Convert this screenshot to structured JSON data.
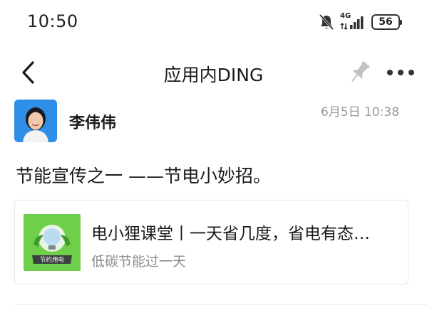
{
  "status_bar": {
    "time": "10:50",
    "network": "4G",
    "battery": "56"
  },
  "header": {
    "title": "应用内DING"
  },
  "message": {
    "sender": "李伟伟",
    "timestamp": "6月5日 10:38",
    "text": "节能宣传之一 ——节电小妙招。",
    "link_card": {
      "title": "电小狸课堂丨一天省几度，省电有态…",
      "subtitle": "低碳节能过一天",
      "thumbnail_caption": "节约用电"
    }
  },
  "icons": {
    "back": "back-arrow-icon",
    "pin": "pin-icon",
    "more": "more-dots-icon",
    "bell_muted": "bell-muted-icon",
    "signal": "signal-icon",
    "battery": "battery-icon"
  },
  "colors": {
    "thumbnail_bg": "#6fcf4a",
    "avatar_bg": "#2f8fe6",
    "timestamp": "#9a9a9a",
    "subtitle": "#8c8c8c"
  }
}
